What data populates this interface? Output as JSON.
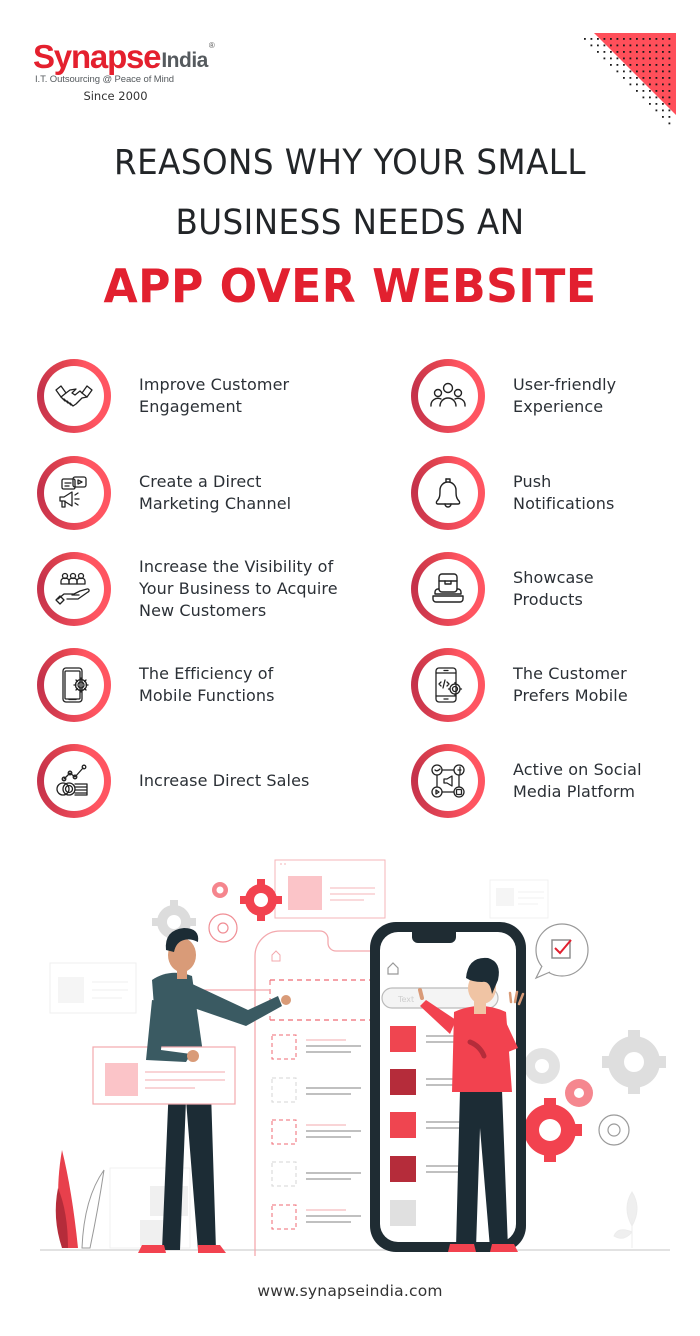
{
  "brand": {
    "name_primary": "Synapse",
    "name_secondary": "India",
    "registered_mark": "®",
    "tagline": "I.T. Outsourcing @ Peace of Mind",
    "since": "Since 2000",
    "primary_color": "#e4202e",
    "secondary_color": "#555a5e"
  },
  "title": {
    "line1": "REASONS WHY YOUR SMALL",
    "line2": "BUSINESS NEEDS AN",
    "accent": "APP OVER WEBSITE",
    "accent_color": "#e2202f"
  },
  "reasons": {
    "left": [
      {
        "label_lines": [
          "Improve Customer",
          "Engagement"
        ],
        "icon": "handshake-icon"
      },
      {
        "label_lines": [
          "Create a Direct",
          "Marketing Channel"
        ],
        "icon": "megaphone-video-icon"
      },
      {
        "label_lines": [
          "Increase the Visibility of",
          "Your Business to Acquire",
          "New Customers"
        ],
        "icon": "hand-people-icon"
      },
      {
        "label_lines": [
          "The Efficiency of",
          "Mobile Functions"
        ],
        "icon": "mobile-gear-icon"
      },
      {
        "label_lines": [
          "Increase Direct Sales"
        ],
        "icon": "coins-growth-icon"
      }
    ],
    "right": [
      {
        "label_lines": [
          "User-friendly",
          "Experience"
        ],
        "icon": "users-group-icon"
      },
      {
        "label_lines": [
          "Push",
          "Notifications"
        ],
        "icon": "bell-icon"
      },
      {
        "label_lines": [
          "Showcase",
          "Products"
        ],
        "icon": "product-box-icon"
      },
      {
        "label_lines": [
          "The Customer",
          "Prefers Mobile"
        ],
        "icon": "mobile-code-icon"
      },
      {
        "label_lines": [
          "Active on Social",
          "Media Platform"
        ],
        "icon": "social-network-icon"
      }
    ],
    "ring_colors": {
      "light": "#ff5561",
      "dark": "#c4314a"
    }
  },
  "illustration": {
    "phone_search_placeholder": "Text"
  },
  "footer": {
    "url": "www.synapseindia.com"
  }
}
